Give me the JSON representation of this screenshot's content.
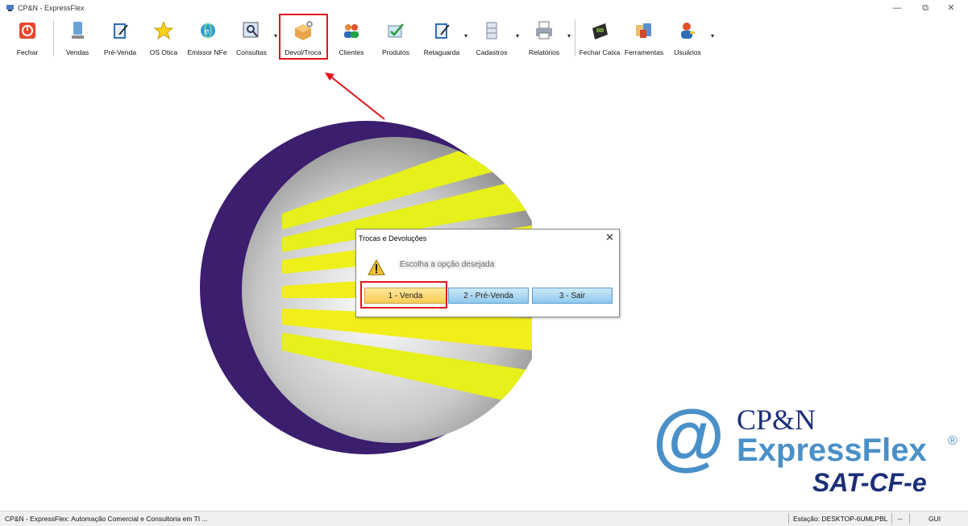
{
  "window": {
    "title": "CP&N - ExpressFlex",
    "controls": {
      "minimize": "—",
      "restore": "⧉",
      "close": "✕"
    }
  },
  "toolbar": {
    "buttons": [
      {
        "label": "Fechar",
        "icon": "power-icon"
      },
      {
        "label": "Vendas",
        "icon": "monitor-icon"
      },
      {
        "label": "Pré-Venda",
        "icon": "clipboard-pen-icon"
      },
      {
        "label": "OS Otica",
        "icon": "star-icon"
      },
      {
        "label": "Emissor NFe",
        "icon": "globe-e-icon"
      },
      {
        "label": "Consultas",
        "icon": "search-window-icon"
      },
      {
        "label": "Devol/Troca",
        "icon": "box-return-icon"
      },
      {
        "label": "Clientes",
        "icon": "users-icon"
      },
      {
        "label": "Produtos",
        "icon": "check-tag-icon"
      },
      {
        "label": "Retaguarda",
        "icon": "clipboard-check-icon"
      },
      {
        "label": "Cadastros",
        "icon": "cabinet-icon"
      },
      {
        "label": "Relatórios",
        "icon": "printer-icon"
      },
      {
        "label": "Fechar Caixa",
        "icon": "cash-register-icon"
      },
      {
        "label": "Ferramentas",
        "icon": "tools-icon"
      },
      {
        "label": "Usuários",
        "icon": "user-key-icon"
      }
    ],
    "dropdown_glyph": "▾"
  },
  "dialog": {
    "title": "Trocas e Devoluções",
    "close": "✕",
    "message": "Escolha a opção desejada",
    "icon": "warning-icon",
    "buttons": [
      "1 - Venda",
      "2 - Pré-Venda",
      "3 - Sair"
    ]
  },
  "brand": {
    "line1": "CP&N",
    "line2": "ExpressFlex",
    "registered": "®",
    "line3": "SAT-CF-e",
    "at": "@"
  },
  "statusbar": {
    "company": "CP&N - ExpressFlex: Automação Comercial e Consultoria em TI ...",
    "station": "Estação: DESKTOP-6UMLPBL",
    "dash": "--",
    "user": "GUI"
  },
  "colors": {
    "highlight": "#e0141d",
    "logo_purple": "#3b1e6e",
    "logo_yellow": "#e6f01a",
    "brand_blue": "#4a90c8",
    "brand_navy": "#1d2f78"
  }
}
